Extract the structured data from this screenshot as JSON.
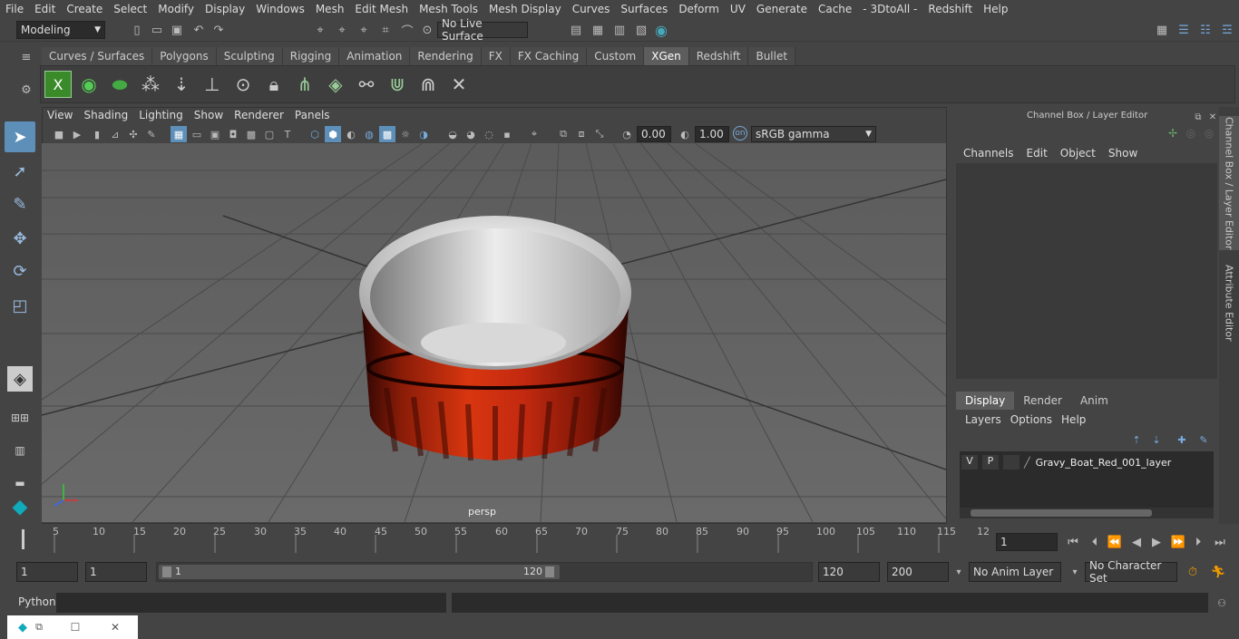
{
  "menubar": [
    "File",
    "Edit",
    "Create",
    "Select",
    "Modify",
    "Display",
    "Windows",
    "Mesh",
    "Edit Mesh",
    "Mesh Tools",
    "Mesh Display",
    "Curves",
    "Surfaces",
    "Deform",
    "UV",
    "Generate",
    "Cache",
    "- 3DtoAll -",
    "Redshift",
    "Help"
  ],
  "status": {
    "mode": "Modeling",
    "live_surface": "No Live Surface"
  },
  "shelf_tabs": [
    "Curves / Surfaces",
    "Polygons",
    "Sculpting",
    "Rigging",
    "Animation",
    "Rendering",
    "FX",
    "FX Caching",
    "Custom",
    "XGen",
    "Redshift",
    "Bullet"
  ],
  "shelf_active": "XGen",
  "viewport": {
    "menu": [
      "View",
      "Shading",
      "Lighting",
      "Show",
      "Renderer",
      "Panels"
    ],
    "near_value": "0.00",
    "far_value": "1.00",
    "color_space": "sRGB gamma",
    "camera_label": "persp"
  },
  "channel_box": {
    "title": "Channel Box / Layer Editor",
    "menu": [
      "Channels",
      "Edit",
      "Object",
      "Show"
    ]
  },
  "layer_editor": {
    "tabs": [
      "Display",
      "Render",
      "Anim"
    ],
    "active_tab": "Display",
    "menu": [
      "Layers",
      "Options",
      "Help"
    ],
    "layer": {
      "v": "V",
      "p": "P",
      "name": "Gravy_Boat_Red_001_layer"
    }
  },
  "side_tabs": [
    "Channel Box / Layer Editor",
    "Attribute Editor"
  ],
  "timeline": {
    "ticks": [
      "5",
      "10",
      "15",
      "20",
      "25",
      "30",
      "35",
      "40",
      "45",
      "50",
      "55",
      "60",
      "65",
      "70",
      "75",
      "80",
      "85",
      "90",
      "95",
      "100",
      "105",
      "110",
      "115",
      "12"
    ],
    "start_label": "1",
    "current_frame": "1"
  },
  "range": {
    "start": "1",
    "playback_start": "1",
    "slider_start": "1",
    "slider_end": "120",
    "playback_end": "120",
    "end": "200",
    "anim_layer": "No Anim Layer",
    "character_set": "No Character Set"
  },
  "command": {
    "label": "Python"
  },
  "colors": {
    "bowl_red": "#c42a10",
    "bowl_inner": "#e8e8e8",
    "ui_bg": "#444444",
    "accent_blue": "#5d8fb8"
  }
}
